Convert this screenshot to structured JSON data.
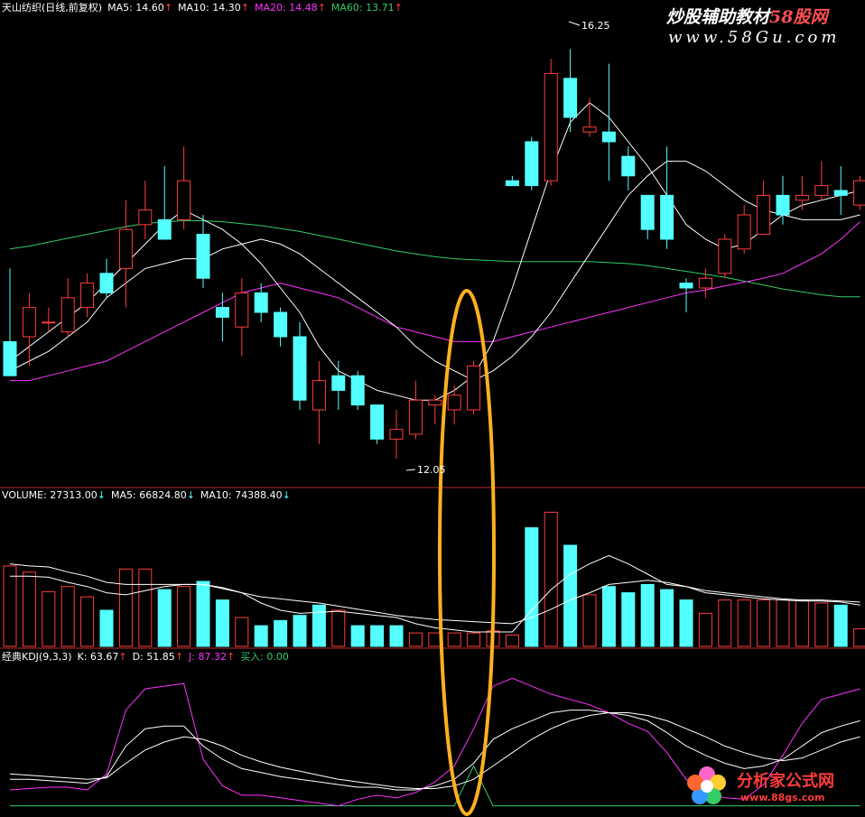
{
  "colors": {
    "up": "#ff3c3c",
    "down": "#54ffff",
    "ma5": "#ffffff",
    "ma10": "#ffffff",
    "ma20": "#ff33ff",
    "ma60": "#33cc66",
    "separator": "#b03030",
    "ellipse": "#ffb020",
    "k": "#ffffff",
    "d": "#ffffff",
    "j": "#ff33ff",
    "buy": "#33cc66",
    "text": "#ffffff"
  },
  "price_header": {
    "name": "天山纺织(日线,前复权)",
    "ma5": "MA5: 14.60",
    "ma10": "MA10: 14.30",
    "ma20": "MA20: 14.48",
    "ma60": "MA60: 13.71",
    "arrow": "↑"
  },
  "volume_header": {
    "volume": "VOLUME: 27313.00",
    "ma5": "MA5: 66824.80",
    "ma10": "MA10: 74388.40",
    "arrow": "↓"
  },
  "kdj_header": {
    "name": "经典KDJ(9,3,3)",
    "k": "K: 63.67",
    "d": "D: 51.85",
    "j": "J: 87.32",
    "buy": "买入: 0.00",
    "arrow": "↑"
  },
  "watermark_top": {
    "text_a": "炒股辅助教材",
    "text_b": "58股网",
    "url": "www.58Gu.com"
  },
  "watermark_bottom": {
    "text": "分析家公式网",
    "url": "www.88gs.com"
  },
  "annotations": {
    "high": "16.25",
    "low": "12.05"
  },
  "chart_data": {
    "type": "candlestick",
    "price_range": [
      11.8,
      16.55
    ],
    "candles": [
      {
        "o": 13.25,
        "h": 14.0,
        "l": 12.9,
        "c": 12.9
      },
      {
        "o": 13.3,
        "h": 13.75,
        "l": 13.0,
        "c": 13.6
      },
      {
        "o": 13.45,
        "h": 13.6,
        "l": 13.35,
        "c": 13.45
      },
      {
        "o": 13.35,
        "h": 13.9,
        "l": 13.3,
        "c": 13.7
      },
      {
        "o": 13.6,
        "h": 13.95,
        "l": 13.5,
        "c": 13.85
      },
      {
        "o": 13.95,
        "h": 14.1,
        "l": 13.7,
        "c": 13.75
      },
      {
        "o": 14.0,
        "h": 14.7,
        "l": 13.6,
        "c": 14.4
      },
      {
        "o": 14.45,
        "h": 14.9,
        "l": 14.3,
        "c": 14.6
      },
      {
        "o": 14.5,
        "h": 15.05,
        "l": 14.35,
        "c": 14.3
      },
      {
        "o": 14.5,
        "h": 15.25,
        "l": 14.4,
        "c": 14.9
      },
      {
        "o": 14.35,
        "h": 14.55,
        "l": 13.8,
        "c": 13.9
      },
      {
        "o": 13.6,
        "h": 13.75,
        "l": 13.25,
        "c": 13.5
      },
      {
        "o": 13.4,
        "h": 13.9,
        "l": 13.1,
        "c": 13.75
      },
      {
        "o": 13.75,
        "h": 13.85,
        "l": 13.45,
        "c": 13.55
      },
      {
        "o": 13.55,
        "h": 13.6,
        "l": 13.2,
        "c": 13.3
      },
      {
        "o": 13.3,
        "h": 13.45,
        "l": 12.55,
        "c": 12.65
      },
      {
        "o": 12.55,
        "h": 13.05,
        "l": 12.2,
        "c": 12.85
      },
      {
        "o": 12.9,
        "h": 13.05,
        "l": 12.55,
        "c": 12.75
      },
      {
        "o": 12.9,
        "h": 12.95,
        "l": 12.55,
        "c": 12.6
      },
      {
        "o": 12.6,
        "h": 12.6,
        "l": 12.2,
        "c": 12.25
      },
      {
        "o": 12.25,
        "h": 12.55,
        "l": 12.05,
        "c": 12.35
      },
      {
        "o": 12.3,
        "h": 12.85,
        "l": 12.25,
        "c": 12.65
      },
      {
        "o": 12.6,
        "h": 12.7,
        "l": 12.4,
        "c": 12.65
      },
      {
        "o": 12.55,
        "h": 12.8,
        "l": 12.4,
        "c": 12.7
      },
      {
        "o": 12.55,
        "h": 13.05,
        "l": 12.5,
        "c": 13.0
      },
      null,
      {
        "o": 14.9,
        "h": 14.95,
        "l": 14.85,
        "c": 14.85
      },
      {
        "o": 15.3,
        "h": 15.35,
        "l": 14.8,
        "c": 14.85
      },
      {
        "o": 14.9,
        "h": 16.15,
        "l": 14.85,
        "c": 16.0
      },
      {
        "o": 15.95,
        "h": 16.25,
        "l": 15.4,
        "c": 15.55
      },
      {
        "o": 15.4,
        "h": 15.75,
        "l": 15.35,
        "c": 15.45
      },
      {
        "o": 15.4,
        "h": 16.1,
        "l": 14.9,
        "c": 15.3
      },
      {
        "o": 15.15,
        "h": 15.25,
        "l": 14.8,
        "c": 14.95
      },
      {
        "o": 14.75,
        "h": 14.75,
        "l": 14.3,
        "c": 14.4
      },
      {
        "o": 14.75,
        "h": 15.25,
        "l": 14.2,
        "c": 14.3
      },
      {
        "o": 13.85,
        "h": 13.9,
        "l": 13.55,
        "c": 13.8
      },
      {
        "o": 13.8,
        "h": 14.0,
        "l": 13.7,
        "c": 13.9
      },
      {
        "o": 13.95,
        "h": 14.35,
        "l": 13.9,
        "c": 14.3
      },
      {
        "o": 14.2,
        "h": 14.65,
        "l": 14.15,
        "c": 14.55
      },
      {
        "o": 14.35,
        "h": 14.9,
        "l": 14.35,
        "c": 14.75
      },
      {
        "o": 14.75,
        "h": 14.95,
        "l": 14.45,
        "c": 14.55
      },
      {
        "o": 14.7,
        "h": 14.95,
        "l": 14.6,
        "c": 14.75
      },
      {
        "o": 14.75,
        "h": 15.1,
        "l": 14.7,
        "c": 14.85
      },
      {
        "o": 14.8,
        "h": 15.05,
        "l": 14.55,
        "c": 14.75
      },
      {
        "o": 14.65,
        "h": 14.95,
        "l": 14.6,
        "c": 14.9
      }
    ],
    "ma5": [
      13.05,
      13.2,
      13.35,
      13.5,
      13.65,
      13.85,
      14.05,
      14.25,
      14.45,
      14.6,
      14.5,
      14.4,
      14.25,
      14.05,
      13.8,
      13.55,
      13.2,
      12.95,
      12.85,
      12.75,
      12.7,
      12.65,
      12.65,
      12.75,
      12.9,
      13.25,
      13.8,
      14.4,
      15.0,
      15.5,
      15.7,
      15.55,
      15.3,
      15.05,
      14.75,
      14.45,
      14.3,
      14.2,
      14.25,
      14.4,
      14.55,
      14.65,
      14.7,
      14.75,
      14.8
    ],
    "ma10": [
      12.95,
      13.05,
      13.15,
      13.3,
      13.45,
      13.7,
      13.85,
      14.0,
      14.05,
      14.1,
      14.1,
      14.2,
      14.25,
      14.3,
      14.25,
      14.15,
      14.0,
      13.85,
      13.7,
      13.55,
      13.4,
      13.2,
      13.05,
      12.95,
      12.85,
      12.95,
      13.1,
      13.3,
      13.55,
      13.85,
      14.15,
      14.45,
      14.75,
      14.95,
      15.1,
      15.1,
      15.0,
      14.85,
      14.7,
      14.6,
      14.55,
      14.5,
      14.5,
      14.5,
      14.55
    ],
    "ma20": [
      12.85,
      12.85,
      12.9,
      12.95,
      13.0,
      13.05,
      13.15,
      13.25,
      13.35,
      13.45,
      13.55,
      13.65,
      13.75,
      13.8,
      13.85,
      13.8,
      13.75,
      13.7,
      13.6,
      13.5,
      13.4,
      13.35,
      13.3,
      13.25,
      13.25,
      13.25,
      13.3,
      13.35,
      13.4,
      13.45,
      13.5,
      13.55,
      13.6,
      13.65,
      13.7,
      13.75,
      13.78,
      13.82,
      13.86,
      13.9,
      13.95,
      14.05,
      14.15,
      14.3,
      14.48
    ],
    "ma60": [
      14.2,
      14.23,
      14.27,
      14.31,
      14.35,
      14.39,
      14.43,
      14.46,
      14.48,
      14.49,
      14.49,
      14.48,
      14.46,
      14.44,
      14.41,
      14.38,
      14.34,
      14.3,
      14.26,
      14.22,
      14.18,
      14.15,
      14.12,
      14.1,
      14.09,
      14.08,
      14.07,
      14.07,
      14.07,
      14.07,
      14.07,
      14.06,
      14.05,
      14.03,
      14.0,
      13.97,
      13.94,
      13.91,
      13.87,
      13.83,
      13.79,
      13.76,
      13.73,
      13.71,
      13.71
    ],
    "volume": [
      78,
      72,
      53,
      58,
      48,
      35,
      75,
      75,
      55,
      58,
      63,
      45,
      28,
      20,
      25,
      30,
      40,
      35,
      20,
      20,
      20,
      13,
      13,
      13,
      13,
      15,
      11,
      115,
      130,
      98,
      50,
      58,
      52,
      60,
      55,
      45,
      32,
      45,
      45,
      45,
      45,
      45,
      42,
      40,
      17
    ],
    "volume_up": [
      true,
      true,
      true,
      true,
      true,
      false,
      true,
      true,
      false,
      true,
      false,
      false,
      true,
      false,
      false,
      false,
      false,
      true,
      false,
      false,
      false,
      true,
      true,
      true,
      true,
      true,
      true,
      false,
      true,
      false,
      true,
      false,
      false,
      false,
      false,
      false,
      true,
      true,
      true,
      true,
      true,
      true,
      true,
      false,
      true
    ],
    "volume_ma5": [
      68,
      68,
      67,
      62,
      58,
      52,
      50,
      54,
      58,
      60,
      60,
      57,
      52,
      42,
      35,
      32,
      33,
      34,
      32,
      30,
      28,
      22,
      18,
      16,
      14,
      14,
      14,
      35,
      55,
      70,
      80,
      88,
      80,
      70,
      60,
      58,
      52,
      50,
      48,
      46,
      45,
      44,
      44,
      43,
      40
    ],
    "volume_ma10": [
      80,
      78,
      77,
      72,
      68,
      62,
      60,
      60,
      60,
      60,
      60,
      56,
      52,
      48,
      46,
      44,
      42,
      39,
      36,
      33,
      30,
      28,
      26,
      25,
      24,
      23,
      22,
      28,
      36,
      45,
      52,
      60,
      62,
      64,
      62,
      58,
      54,
      52,
      50,
      48,
      46,
      45,
      45,
      44,
      43
    ],
    "volume_range": [
      0,
      140
    ],
    "kdj_k": [
      20,
      20,
      19,
      18,
      17,
      22,
      45,
      58,
      60,
      60,
      45,
      35,
      28,
      25,
      22,
      20,
      18,
      16,
      14,
      14,
      12,
      12,
      15,
      20,
      32,
      50,
      58,
      64,
      70,
      72,
      72,
      70,
      68,
      64,
      55,
      45,
      38,
      32,
      28,
      30,
      35,
      45,
      55,
      60,
      64
    ],
    "kdj_d": [
      24,
      23,
      22,
      21,
      20,
      21,
      32,
      42,
      48,
      52,
      50,
      45,
      38,
      33,
      29,
      26,
      23,
      20,
      18,
      16,
      14,
      13,
      13,
      15,
      20,
      30,
      40,
      50,
      58,
      64,
      68,
      70,
      70,
      68,
      64,
      58,
      52,
      45,
      40,
      36,
      34,
      36,
      42,
      48,
      52
    ],
    "kdj_j": [
      12,
      13,
      14,
      14,
      12,
      24,
      72,
      88,
      90,
      92,
      35,
      15,
      8,
      8,
      6,
      4,
      2,
      0,
      5,
      8,
      6,
      10,
      18,
      30,
      58,
      90,
      96,
      90,
      84,
      80,
      76,
      70,
      62,
      56,
      40,
      20,
      10,
      6,
      5,
      16,
      38,
      62,
      80,
      84,
      88
    ],
    "kdj_buy": [
      0,
      0,
      0,
      0,
      0,
      0,
      0,
      0,
      0,
      0,
      0,
      0,
      0,
      0,
      0,
      0,
      0,
      0,
      0,
      0,
      0,
      0,
      0,
      0,
      30,
      0,
      0,
      0,
      0,
      0,
      0,
      0,
      0,
      0,
      0,
      0,
      0,
      0,
      0,
      0,
      0,
      0,
      0,
      0,
      0
    ],
    "kdj_range": [
      -5,
      105
    ]
  }
}
